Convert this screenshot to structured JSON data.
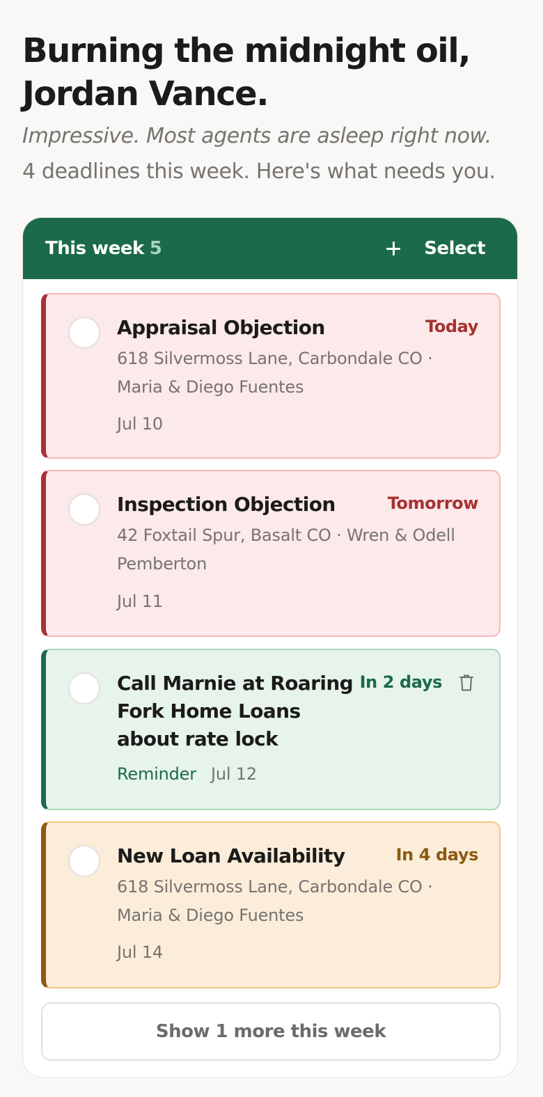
{
  "header": {
    "greeting": "Burning the midnight oil, Jordan Vance.",
    "tagline": "Impressive. Most agents are asleep right now.",
    "summary": "4 deadlines this week. Here's what needs you."
  },
  "panel": {
    "title": "This week",
    "count": "5",
    "add_icon": "plus-icon",
    "select_label": "Select",
    "more_label": "Show 1 more this week"
  },
  "tasks": [
    {
      "title": "Appraisal Objection",
      "due": "Today",
      "property": "618 Silvermoss Lane, Carbondale CO · Maria & Diego Fuentes",
      "date": "Jul 10",
      "status": "urgent"
    },
    {
      "title": "Inspection Objection",
      "due": "Tomorrow",
      "property": "42 Foxtail Spur, Basalt CO · Wren & Odell Pemberton",
      "date": "Jul 11",
      "status": "urgent"
    },
    {
      "title": "Call Marnie at Roaring Fork Home Loans about rate lock",
      "due": "In 2 days",
      "type_label": "Reminder",
      "date": "Jul 12",
      "status": "reminder",
      "action_icon": "trash-icon"
    },
    {
      "title": "New Loan Availability",
      "due": "In 4 days",
      "property": "618 Silvermoss Lane, Carbondale CO · Maria & Diego Fuentes",
      "date": "Jul 14",
      "status": "upcoming"
    }
  ],
  "colors": {
    "brand_green": "#1b6a4a",
    "urgent_red": "#a63232",
    "upcoming_amber": "#8c5a10"
  }
}
